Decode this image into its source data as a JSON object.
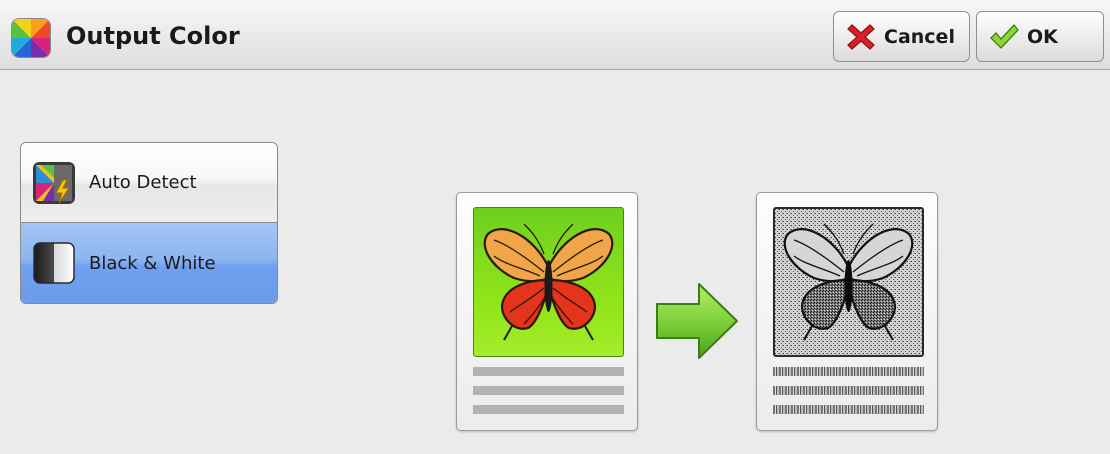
{
  "header": {
    "title": "Output Color",
    "cancel_label": "Cancel",
    "ok_label": "OK"
  },
  "options": [
    {
      "label": "Auto Detect",
      "icon": "auto-detect-icon",
      "selected": false
    },
    {
      "label": "Black & White",
      "icon": "black-white-icon",
      "selected": true
    }
  ],
  "preview": {
    "source": "butterfly-color-icon",
    "result": "butterfly-bw-icon"
  },
  "colors": {
    "selected": "#8db5f0",
    "preview_green": "#8fe31a",
    "arrow_green": "#6cc32a",
    "cancel_red": "#d8202a"
  }
}
